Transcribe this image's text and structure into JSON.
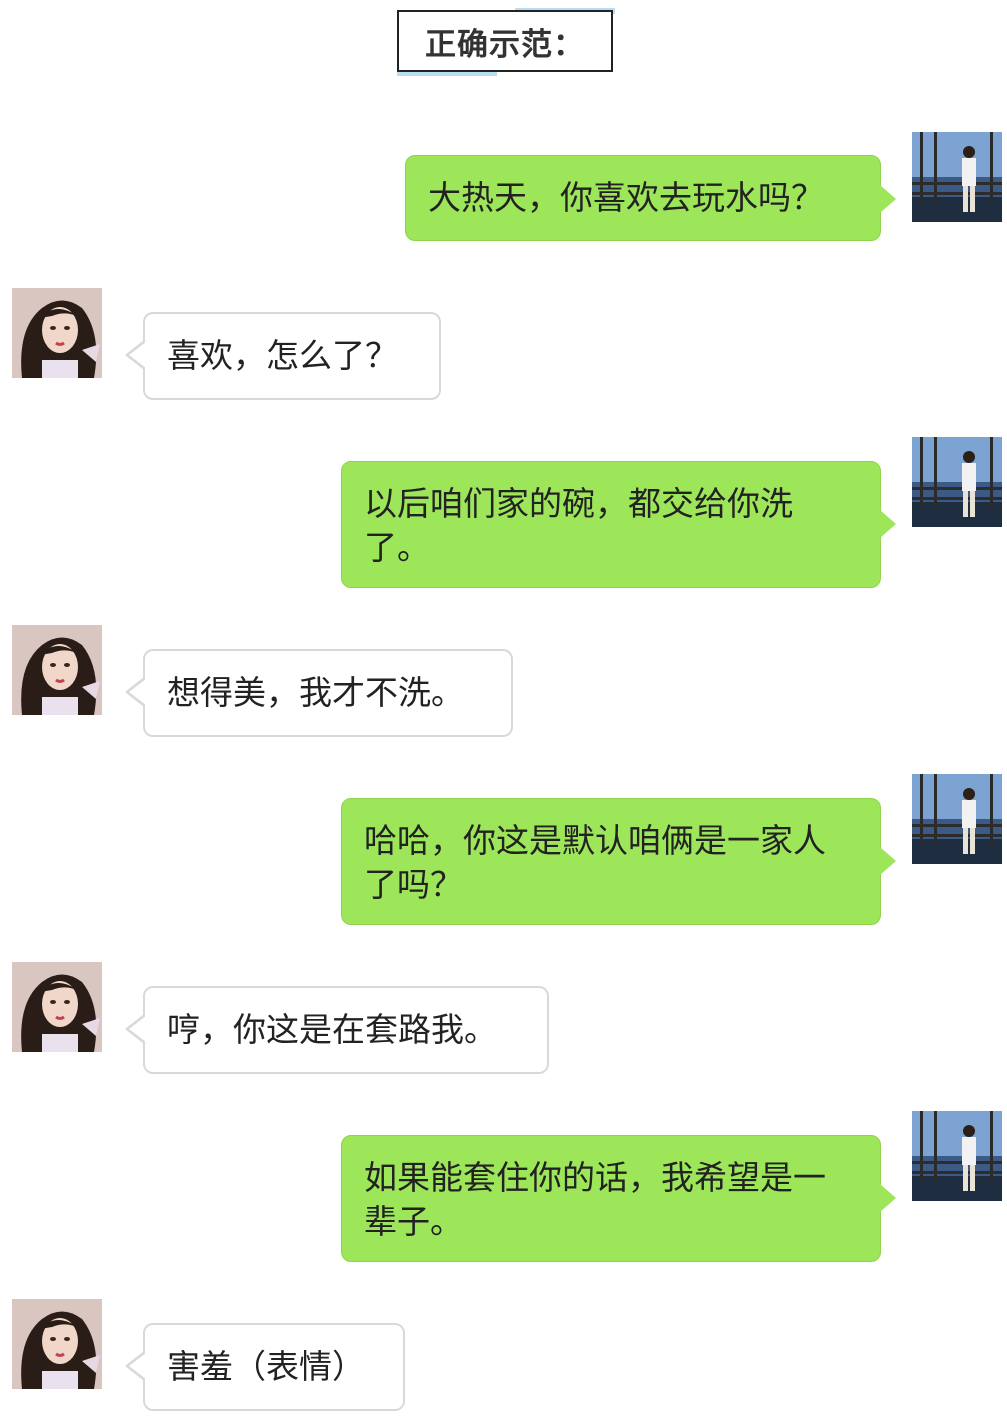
{
  "title": "正确示范：",
  "colors": {
    "my_bubble": "#9de65a",
    "their_bubble": "#ffffff",
    "title_accent": "#b8dcf4"
  },
  "messages": [
    {
      "sender": "me",
      "avatar": "male-avatar",
      "text": "大热天，你喜欢去玩水吗？"
    },
    {
      "sender": "them",
      "avatar": "female-avatar",
      "text": "喜欢，怎么了？"
    },
    {
      "sender": "me",
      "avatar": "male-avatar",
      "text": "以后咱们家的碗，都交给你洗了。"
    },
    {
      "sender": "them",
      "avatar": "female-avatar",
      "text": "想得美，我才不洗。"
    },
    {
      "sender": "me",
      "avatar": "male-avatar",
      "text": "哈哈，你这是默认咱俩是一家人了吗？"
    },
    {
      "sender": "them",
      "avatar": "female-avatar",
      "text": "哼，你这是在套路我。"
    },
    {
      "sender": "me",
      "avatar": "male-avatar",
      "text": "如果能套住你的话，我希望是一辈子。"
    },
    {
      "sender": "them",
      "avatar": "female-avatar",
      "text": "害羞（表情）"
    }
  ]
}
